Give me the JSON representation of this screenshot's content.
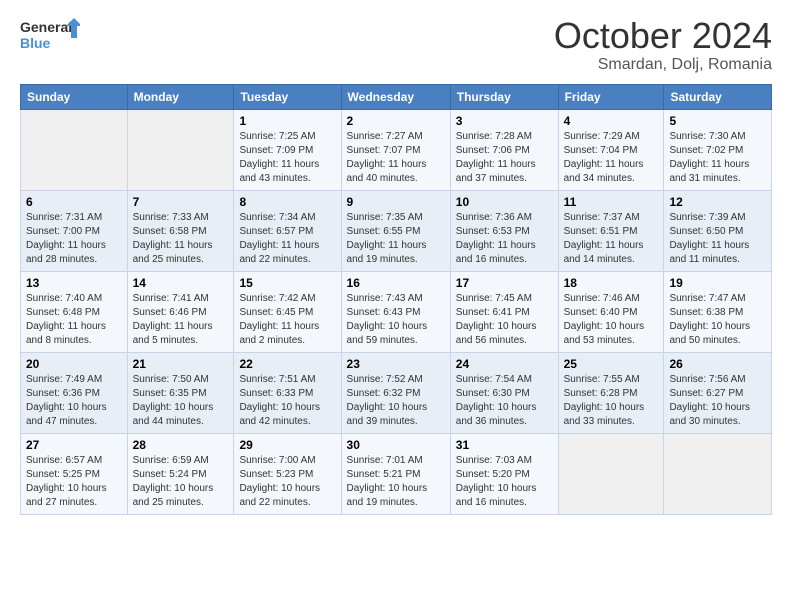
{
  "header": {
    "logo_general": "General",
    "logo_blue": "Blue",
    "month": "October 2024",
    "location": "Smardan, Dolj, Romania"
  },
  "weekdays": [
    "Sunday",
    "Monday",
    "Tuesday",
    "Wednesday",
    "Thursday",
    "Friday",
    "Saturday"
  ],
  "weeks": [
    [
      {
        "day": "",
        "info": ""
      },
      {
        "day": "",
        "info": ""
      },
      {
        "day": "1",
        "info": "Sunrise: 7:25 AM\nSunset: 7:09 PM\nDaylight: 11 hours and 43 minutes."
      },
      {
        "day": "2",
        "info": "Sunrise: 7:27 AM\nSunset: 7:07 PM\nDaylight: 11 hours and 40 minutes."
      },
      {
        "day": "3",
        "info": "Sunrise: 7:28 AM\nSunset: 7:06 PM\nDaylight: 11 hours and 37 minutes."
      },
      {
        "day": "4",
        "info": "Sunrise: 7:29 AM\nSunset: 7:04 PM\nDaylight: 11 hours and 34 minutes."
      },
      {
        "day": "5",
        "info": "Sunrise: 7:30 AM\nSunset: 7:02 PM\nDaylight: 11 hours and 31 minutes."
      }
    ],
    [
      {
        "day": "6",
        "info": "Sunrise: 7:31 AM\nSunset: 7:00 PM\nDaylight: 11 hours and 28 minutes."
      },
      {
        "day": "7",
        "info": "Sunrise: 7:33 AM\nSunset: 6:58 PM\nDaylight: 11 hours and 25 minutes."
      },
      {
        "day": "8",
        "info": "Sunrise: 7:34 AM\nSunset: 6:57 PM\nDaylight: 11 hours and 22 minutes."
      },
      {
        "day": "9",
        "info": "Sunrise: 7:35 AM\nSunset: 6:55 PM\nDaylight: 11 hours and 19 minutes."
      },
      {
        "day": "10",
        "info": "Sunrise: 7:36 AM\nSunset: 6:53 PM\nDaylight: 11 hours and 16 minutes."
      },
      {
        "day": "11",
        "info": "Sunrise: 7:37 AM\nSunset: 6:51 PM\nDaylight: 11 hours and 14 minutes."
      },
      {
        "day": "12",
        "info": "Sunrise: 7:39 AM\nSunset: 6:50 PM\nDaylight: 11 hours and 11 minutes."
      }
    ],
    [
      {
        "day": "13",
        "info": "Sunrise: 7:40 AM\nSunset: 6:48 PM\nDaylight: 11 hours and 8 minutes."
      },
      {
        "day": "14",
        "info": "Sunrise: 7:41 AM\nSunset: 6:46 PM\nDaylight: 11 hours and 5 minutes."
      },
      {
        "day": "15",
        "info": "Sunrise: 7:42 AM\nSunset: 6:45 PM\nDaylight: 11 hours and 2 minutes."
      },
      {
        "day": "16",
        "info": "Sunrise: 7:43 AM\nSunset: 6:43 PM\nDaylight: 10 hours and 59 minutes."
      },
      {
        "day": "17",
        "info": "Sunrise: 7:45 AM\nSunset: 6:41 PM\nDaylight: 10 hours and 56 minutes."
      },
      {
        "day": "18",
        "info": "Sunrise: 7:46 AM\nSunset: 6:40 PM\nDaylight: 10 hours and 53 minutes."
      },
      {
        "day": "19",
        "info": "Sunrise: 7:47 AM\nSunset: 6:38 PM\nDaylight: 10 hours and 50 minutes."
      }
    ],
    [
      {
        "day": "20",
        "info": "Sunrise: 7:49 AM\nSunset: 6:36 PM\nDaylight: 10 hours and 47 minutes."
      },
      {
        "day": "21",
        "info": "Sunrise: 7:50 AM\nSunset: 6:35 PM\nDaylight: 10 hours and 44 minutes."
      },
      {
        "day": "22",
        "info": "Sunrise: 7:51 AM\nSunset: 6:33 PM\nDaylight: 10 hours and 42 minutes."
      },
      {
        "day": "23",
        "info": "Sunrise: 7:52 AM\nSunset: 6:32 PM\nDaylight: 10 hours and 39 minutes."
      },
      {
        "day": "24",
        "info": "Sunrise: 7:54 AM\nSunset: 6:30 PM\nDaylight: 10 hours and 36 minutes."
      },
      {
        "day": "25",
        "info": "Sunrise: 7:55 AM\nSunset: 6:28 PM\nDaylight: 10 hours and 33 minutes."
      },
      {
        "day": "26",
        "info": "Sunrise: 7:56 AM\nSunset: 6:27 PM\nDaylight: 10 hours and 30 minutes."
      }
    ],
    [
      {
        "day": "27",
        "info": "Sunrise: 6:57 AM\nSunset: 5:25 PM\nDaylight: 10 hours and 27 minutes."
      },
      {
        "day": "28",
        "info": "Sunrise: 6:59 AM\nSunset: 5:24 PM\nDaylight: 10 hours and 25 minutes."
      },
      {
        "day": "29",
        "info": "Sunrise: 7:00 AM\nSunset: 5:23 PM\nDaylight: 10 hours and 22 minutes."
      },
      {
        "day": "30",
        "info": "Sunrise: 7:01 AM\nSunset: 5:21 PM\nDaylight: 10 hours and 19 minutes."
      },
      {
        "day": "31",
        "info": "Sunrise: 7:03 AM\nSunset: 5:20 PM\nDaylight: 10 hours and 16 minutes."
      },
      {
        "day": "",
        "info": ""
      },
      {
        "day": "",
        "info": ""
      }
    ]
  ]
}
